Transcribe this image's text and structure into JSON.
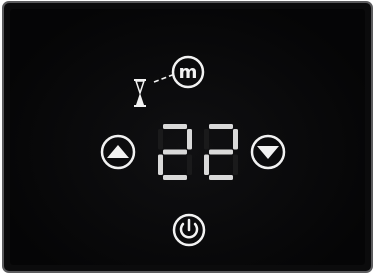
{
  "thermostat": {
    "temperature": "22",
    "buttons": {
      "mode": {
        "glyph": "m"
      }
    }
  },
  "icons": {
    "mode": "mode-m-icon",
    "timer": "hourglass-icon",
    "up": "triangle-up-icon",
    "down": "triangle-down-icon",
    "power": "power-icon"
  },
  "colors": {
    "panel": "#0b0b0c",
    "frame": "#5c5c5e",
    "icon": "#f2f2f2",
    "segment_lit": "#d9d9d9",
    "segment_unlit": "#1a1a1b"
  }
}
